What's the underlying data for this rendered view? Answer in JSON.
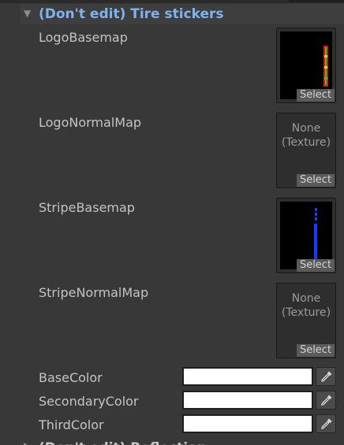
{
  "section": {
    "title": "(Don't edit) Tire stickers",
    "expanded": true
  },
  "textures": [
    {
      "label": "LogoBasemap",
      "assigned": true,
      "select_label": "Select",
      "preview": "red-green-vertical-logo"
    },
    {
      "label": "LogoNormalMap",
      "assigned": false,
      "none_text": "None\n(Texture)",
      "select_label": "Select"
    },
    {
      "label": "StripeBasemap",
      "assigned": true,
      "select_label": "Select",
      "preview": "blue-vertical-stripe"
    },
    {
      "label": "StripeNormalMap",
      "assigned": false,
      "none_text": "None\n(Texture)",
      "select_label": "Select"
    }
  ],
  "colors": [
    {
      "label": "BaseColor",
      "value": "#FFFFFF"
    },
    {
      "label": "SecondaryColor",
      "value": "#FFFFFF"
    },
    {
      "label": "ThirdColor",
      "value": "#FFFFFF"
    }
  ],
  "next_section": {
    "title": "(Don't edit) Reflection"
  },
  "theme": {
    "header_text": "#7FB2F0",
    "label_text": "#C4C4C4",
    "background": "#383838"
  }
}
